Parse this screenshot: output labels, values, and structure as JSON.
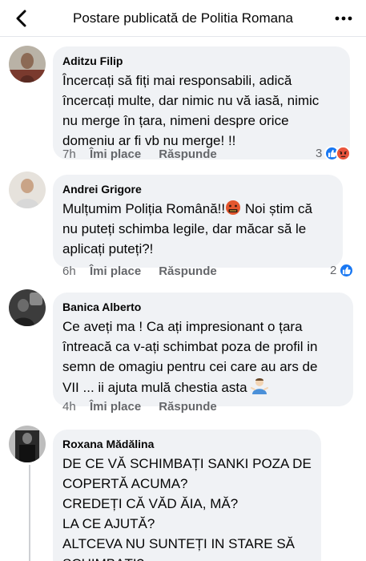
{
  "header": {
    "title": "Postare publicată de Politia Romana",
    "back_icon": "chevron-left-icon",
    "more_icon": "more-horizontal-icon"
  },
  "comments": [
    {
      "author": "Aditzu Filip",
      "lines": [
        "Încercați să fiți mai responsabili, adică",
        "încercați multe,  dar nimic nu vă iasă, nimic",
        "nu merge în țara,  nimeni despre orice",
        "domeniu ar fi vb nu merge! !!"
      ],
      "age": "7h",
      "like_label": "Îmi place",
      "reply_label": "Răspunde",
      "reaction_count": "3",
      "reactions": [
        "like",
        "angry"
      ]
    },
    {
      "author": "Andrei Grigore",
      "lines": [
        "Mulțumim Poliția Română!!",
        "Noi știm că",
        "nu puteți schimba legile, dar măcar să le",
        "aplicați puteți?!"
      ],
      "emoji": "cursing-face-emoji",
      "age": "6h",
      "like_label": "Îmi place",
      "reply_label": "Răspunde",
      "reaction_count": "2",
      "reactions": [
        "like"
      ]
    },
    {
      "author": "Banica Alberto",
      "lines": [
        "Ce aveți ma ! Ca ați impresionant o țara",
        "întreacă ca v-ați schimbat poza de profil in",
        "semn de omagiu pentru cei care au ars de",
        "VII ... ii ajuta mulă chestia asta"
      ],
      "emoji": "man-shrugging-emoji",
      "age": "4h",
      "like_label": "Îmi place",
      "reply_label": "Răspunde"
    },
    {
      "author": "Roxana Mădălina",
      "lines": [
        "DE CE VĂ SCHIMBAȚI SANKI POZA DE",
        "COPERTĂ ACUMA?",
        "CREDEȚI CĂ VĂD ĂIA, MĂ?",
        "LA CE AJUTĂ?",
        "ALTCEVA NU SUNTEȚI IN STARE SĂ",
        "SCHIMBAȚI?"
      ]
    }
  ],
  "colors": {
    "bubble": "#f0f2f5",
    "meta_text": "#65676b",
    "like_blue": "#1877f2",
    "angry_orange": "#f28b31"
  }
}
